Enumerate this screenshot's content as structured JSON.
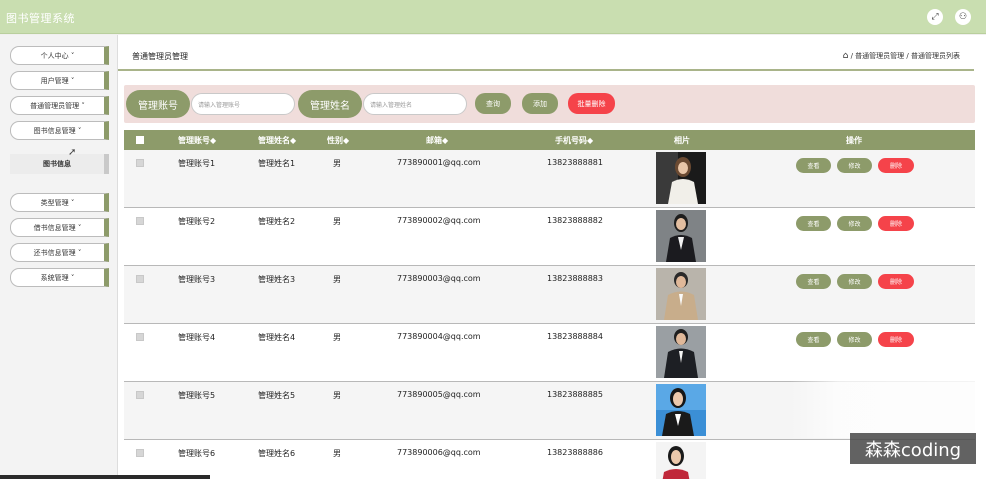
{
  "app": {
    "title": "图书管理系统"
  },
  "topbar": {
    "fullscreen_icon": "expand-icon",
    "user_icon": "user-icon"
  },
  "sidebar": {
    "items": [
      {
        "label": "个人中心 ˅"
      },
      {
        "label": "用户管理 ˅"
      },
      {
        "label": "普通管理员管理 ˅"
      },
      {
        "label": "图书信息管理 ˅"
      },
      {
        "label": "图书信息"
      },
      {
        "label": "类型管理 ˅"
      },
      {
        "label": "借书信息管理 ˅"
      },
      {
        "label": "还书信息管理 ˅"
      },
      {
        "label": "系统管理 ˅"
      }
    ]
  },
  "header": {
    "title": "普通管理员管理",
    "breadcrumb": "/ 普通管理员管理 / 普通管理员列表"
  },
  "search": {
    "account_label": "管理账号",
    "account_placeholder": "请输入管理账号",
    "name_label": "管理姓名",
    "name_placeholder": "请输入管理姓名",
    "query_label": "查询",
    "add_label": "添加",
    "batch_delete_label": "批量删除"
  },
  "table": {
    "columns": [
      "管理账号◆",
      "管理姓名◆",
      "性别◆",
      "邮箱◆",
      "手机号码◆",
      "相片",
      "操作"
    ],
    "rows": [
      {
        "account": "管理账号1",
        "name": "管理姓名1",
        "gender": "男",
        "email": "773890001@qq.com",
        "phone": "13823888881",
        "view": "查看",
        "edit": "修改",
        "delete": "删除"
      },
      {
        "account": "管理账号2",
        "name": "管理姓名2",
        "gender": "男",
        "email": "773890002@qq.com",
        "phone": "13823888882",
        "view": "查看",
        "edit": "修改",
        "delete": "删除"
      },
      {
        "account": "管理账号3",
        "name": "管理姓名3",
        "gender": "男",
        "email": "773890003@qq.com",
        "phone": "13823888883",
        "view": "查看",
        "edit": "修改",
        "delete": "删除"
      },
      {
        "account": "管理账号4",
        "name": "管理姓名4",
        "gender": "男",
        "email": "773890004@qq.com",
        "phone": "13823888884",
        "view": "查看",
        "edit": "修改",
        "delete": "删除"
      },
      {
        "account": "管理账号5",
        "name": "管理姓名5",
        "gender": "男",
        "email": "773890005@qq.com",
        "phone": "13823888885"
      },
      {
        "account": "管理账号6",
        "name": "管理姓名6",
        "gender": "男",
        "email": "773890006@qq.com",
        "phone": "13823888886"
      }
    ]
  },
  "watermark": {
    "text": "森森coding"
  },
  "colors": {
    "accent": "#8d9b6a",
    "danger": "#f5434a",
    "topbar": "#c9deb0",
    "search_bg": "#f0dddb"
  }
}
